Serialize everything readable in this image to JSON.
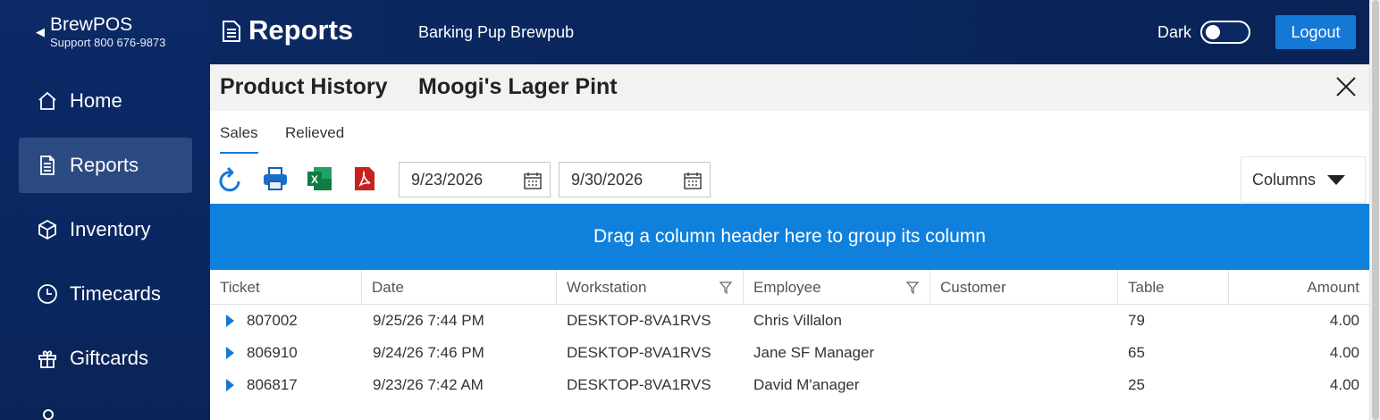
{
  "sidebar": {
    "brand_title": "BrewPOS",
    "brand_support": "Support 800 676-9873",
    "items": [
      {
        "label": "Home",
        "icon": "home-icon"
      },
      {
        "label": "Reports",
        "icon": "reports-icon",
        "active": true
      },
      {
        "label": "Inventory",
        "icon": "box-icon"
      },
      {
        "label": "Timecards",
        "icon": "clock-icon"
      },
      {
        "label": "Giftcards",
        "icon": "gift-icon"
      }
    ]
  },
  "header": {
    "title": "Reports",
    "store": "Barking Pup Brewpub",
    "dark_label": "Dark",
    "dark_on": false,
    "logout_label": "Logout"
  },
  "panel": {
    "title": "Product History",
    "product": "Moogi's Lager Pint"
  },
  "tabs": [
    "Sales",
    "Relieved"
  ],
  "toolbar": {
    "start_date": "9/23/2026",
    "end_date": "9/30/2026",
    "columns_label": "Columns"
  },
  "group_hint": "Drag a column header here to group its column",
  "grid": {
    "columns": [
      "Ticket",
      "Date",
      "Workstation",
      "Employee",
      "Customer",
      "Table",
      "Amount"
    ],
    "rows": [
      {
        "ticket": "807002",
        "date": "9/25/26 7:44 PM",
        "workstation": "DESKTOP-8VA1RVS",
        "employee": "Chris Villalon",
        "customer": "",
        "table": "79",
        "amount": "4.00"
      },
      {
        "ticket": "806910",
        "date": "9/24/26 7:46 PM",
        "workstation": "DESKTOP-8VA1RVS",
        "employee": "Jane SF Manager",
        "customer": "",
        "table": "65",
        "amount": "4.00"
      },
      {
        "ticket": "806817",
        "date": "9/23/26 7:42 AM",
        "workstation": "DESKTOP-8VA1RVS",
        "employee": "David M'anager",
        "customer": "",
        "table": "25",
        "amount": "4.00"
      }
    ]
  },
  "colors": {
    "sidebar_bg": "#0b2a66",
    "accent": "#1479d6",
    "group_bar": "#0f80db"
  }
}
